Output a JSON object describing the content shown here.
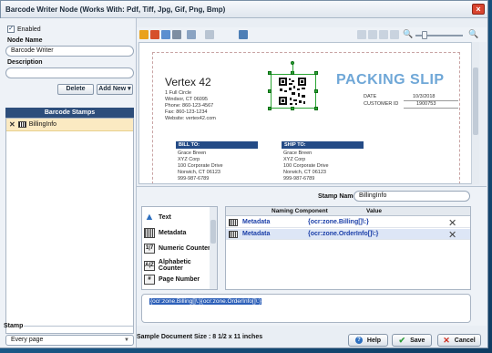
{
  "window": {
    "title": "Barcode Writer Node   (Works With: Pdf, Tiff, Jpg, Gif, Png, Bmp)",
    "close_label": "×"
  },
  "left": {
    "enabled_label": "Enabled",
    "node_name_label": "Node Name",
    "node_name_value": "Barcode Writer",
    "description_label": "Description",
    "description_value": "",
    "delete_label": "Delete",
    "add_new_label": "Add New ▾",
    "stamps_header": "Barcode Stamps",
    "stamps": [
      {
        "label": "BillingInfo"
      }
    ],
    "stamp_section_label": "Stamp",
    "stamp_select_value": "Every page"
  },
  "preview": {
    "company": "Vertex 42",
    "address_lines": [
      "1 Full Circle",
      "Windsor, CT 06095",
      "Phone: 860-123-4567",
      "Fax: 860-123-1234",
      "Website: vertex42.com"
    ],
    "title": "PACKING SLIP",
    "date_label": "DATE",
    "date_value": "10/3/2018",
    "customer_label": "CUSTOMER ID",
    "customer_value": "1900753",
    "bill_to_label": "BILL TO:",
    "ship_to_label": "SHIP TO:",
    "bill_to": [
      "Grace Breen",
      "XYZ Corp",
      "100 Corporate Drive",
      "Norwich, CT 06123",
      "999-987-6789"
    ],
    "ship_to": [
      "Grace Breen",
      "XYZ Corp",
      "100 Corporate Drive",
      "Norwich, CT 06123",
      "999-987-6789"
    ]
  },
  "editor": {
    "stamp_name_label": "Stamp Name",
    "stamp_name_value": "BillingInfo",
    "components": [
      {
        "label": "Text",
        "icon": "text-icon"
      },
      {
        "label": "Metadata",
        "icon": "metadata-icon"
      },
      {
        "label": "Numeric Counter",
        "icon": "numeric-counter-icon"
      },
      {
        "label": "Alphabetic Counter",
        "icon": "alphabetic-counter-icon"
      },
      {
        "label": "Page Number",
        "icon": "page-number-icon"
      }
    ],
    "grid_headers": {
      "naming": "Naming Component",
      "value": "Value"
    },
    "rows": [
      {
        "component": "Metadata",
        "value": "{ocr:zone.Billing[]\\:}"
      },
      {
        "component": "Metadata",
        "value": "{ocr:zone.OrderInfo[]\\:}"
      }
    ],
    "expression": "{ocr:zone.Billing[]\\:}{ocr:zone.OrderInfo[]\\:}"
  },
  "footer": {
    "sample_size": "Sample Document Size : 8 1/2 x 11 inches",
    "help_label": "Help",
    "save_label": "Save",
    "cancel_label": "Cancel"
  }
}
